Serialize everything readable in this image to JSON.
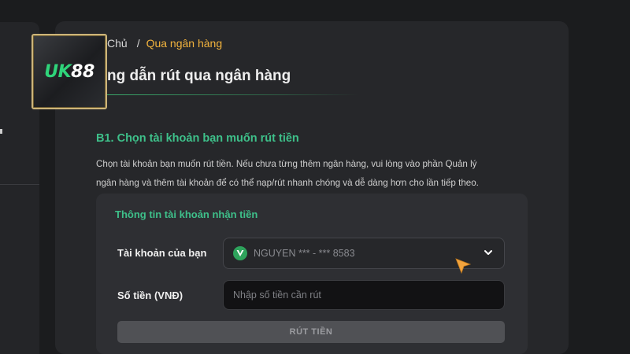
{
  "logo": {
    "text_a": "UK",
    "text_b": "88"
  },
  "breadcrumb": {
    "home": "Chủ",
    "separator": "/",
    "current": "Qua ngân hàng"
  },
  "page": {
    "title": "ng dẫn rút qua ngân hàng"
  },
  "step": {
    "title": "B1. Chọn tài khoản bạn muốn rút tiền",
    "line1": "Chọn tài khoản bạn muốn rút tiền. Nếu chưa từng thêm ngân hàng, vui lòng vào phần Quản lý",
    "line2": "ngân hàng và thêm tài khoản để có thể nạp/rút nhanh chóng và dễ dàng hơn cho lần tiếp theo."
  },
  "form": {
    "heading": "Thông tin tài khoản nhận tiền",
    "account_label": "Tài khoản của bạn",
    "account_value": "NGUYEN *** - *** 8583",
    "amount_label": "Số tiền (VNĐ)",
    "amount_placeholder": "Nhập số tiền cần rút",
    "amount_value": "",
    "submit_label": "RÚT TIỀN"
  },
  "colors": {
    "accent_green": "#3ec08a",
    "breadcrumb_active": "#f2b33d",
    "panel_bg": "#26272a",
    "page_bg": "#1b1c1e"
  },
  "icons": {
    "bank": "bank-shield-icon",
    "dropdown": "chevron-down-icon",
    "pointer": "mouse-cursor-icon"
  }
}
